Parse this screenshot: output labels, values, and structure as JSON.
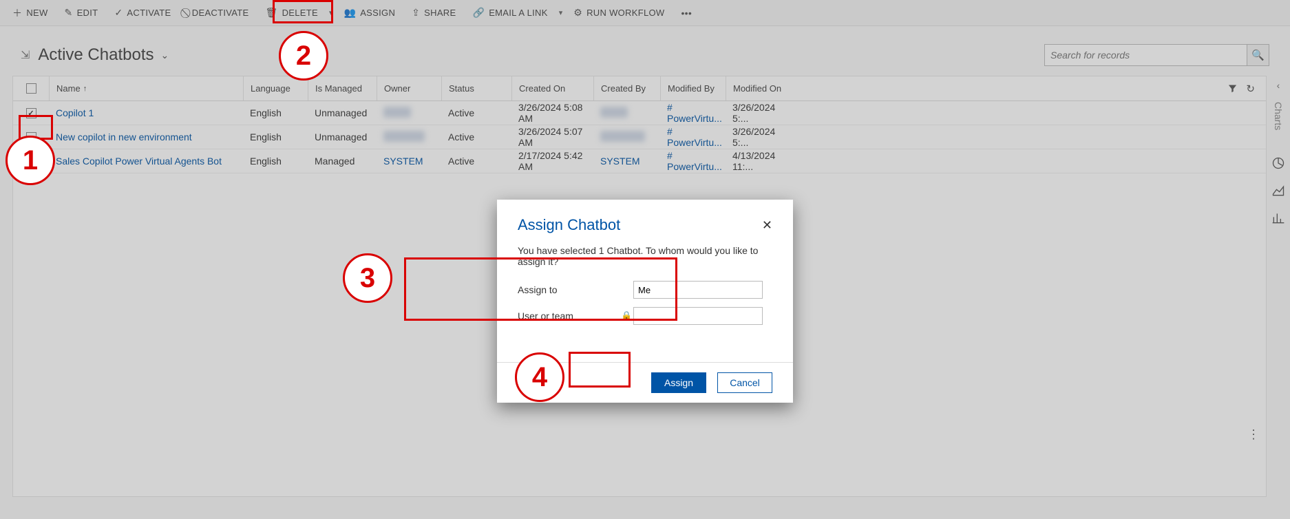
{
  "commands": {
    "new": "NEW",
    "edit": "EDIT",
    "activate": "ACTIVATE",
    "deactivate": "DEACTIVATE",
    "delete": "DELETE",
    "assign": "ASSIGN",
    "share": "SHARE",
    "email_link": "EMAIL A LINK",
    "run_workflow": "RUN WORKFLOW"
  },
  "view": {
    "title": "Active Chatbots",
    "search_placeholder": "Search for records"
  },
  "grid": {
    "headers": {
      "name": "Name",
      "language": "Language",
      "managed": "Is Managed",
      "owner": "Owner",
      "status": "Status",
      "created_on": "Created On",
      "created_by": "Created By",
      "modified_by": "Modified By",
      "modified_on": "Modified On"
    },
    "rows": [
      {
        "checked": true,
        "name": "Copilot 1",
        "language": "English",
        "managed": "Unmanaged",
        "owner": "████",
        "owner_blurred": true,
        "status": "Active",
        "created_on": "3/26/2024 5:08 AM",
        "created_by": "████",
        "created_by_blurred": true,
        "modified_by": "# PowerVirtu...",
        "modified_on": "3/26/2024 5:..."
      },
      {
        "checked": false,
        "name": "New copilot in new environment",
        "language": "English",
        "managed": "Unmanaged",
        "owner": "████ ████",
        "owner_blurred": true,
        "status": "Active",
        "created_on": "3/26/2024 5:07 AM",
        "created_by": "████ ████",
        "created_by_blurred": true,
        "modified_by": "# PowerVirtu...",
        "modified_on": "3/26/2024 5:..."
      },
      {
        "checked": false,
        "name": "Sales Copilot Power Virtual Agents Bot",
        "language": "English",
        "managed": "Managed",
        "owner": "SYSTEM",
        "owner_blurred": false,
        "status": "Active",
        "created_on": "2/17/2024 5:42 AM",
        "created_by": "SYSTEM",
        "created_by_blurred": false,
        "modified_by": "# PowerVirtu...",
        "modified_on": "4/13/2024 11:..."
      }
    ]
  },
  "right_rail": {
    "label": "Charts"
  },
  "dialog": {
    "title": "Assign Chatbot",
    "message": "You have selected 1 Chatbot. To whom would you like to assign it?",
    "assign_to_label": "Assign to",
    "assign_to_value": "Me",
    "user_team_label": "User or team",
    "user_team_value": "",
    "assign_btn": "Assign",
    "cancel_btn": "Cancel"
  },
  "annotations": {
    "n1": "1",
    "n2": "2",
    "n3": "3",
    "n4": "4"
  }
}
